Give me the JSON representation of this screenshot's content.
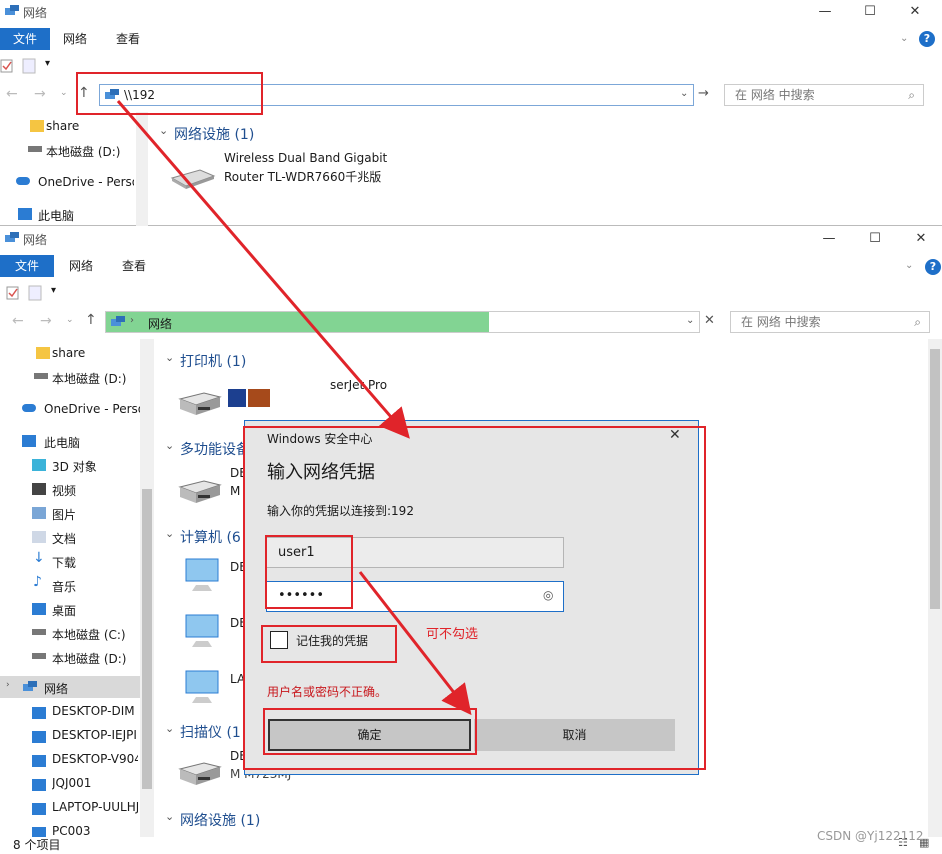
{
  "window1": {
    "title": "网络",
    "tabs": {
      "file": "文件",
      "network": "网络",
      "view": "查看"
    },
    "address": "\\\\192",
    "search_placeholder": "在 网络 中搜索",
    "nav": [
      "share",
      "本地磁盘 (D:)",
      "OneDrive - Perso",
      "此电脑"
    ],
    "group_header": "网络设施 (1)",
    "device_line1": "Wireless Dual Band Gigabit",
    "device_line2": "Router TL-WDR7660千兆版"
  },
  "window2": {
    "title": "网络",
    "tabs": {
      "file": "文件",
      "network": "网络",
      "view": "查看"
    },
    "breadcrumb": "网络",
    "search_placeholder": "在 网络 中搜索",
    "nav": [
      "share",
      "本地磁盘 (D:)",
      "OneDrive - Perso",
      "此电脑",
      "3D 对象",
      "视频",
      "图片",
      "文档",
      "下载",
      "音乐",
      "桌面",
      "本地磁盘 (C:)",
      "本地磁盘 (D:)",
      "网络",
      "DESKTOP-DIM",
      "DESKTOP-IEJPI",
      "DESKTOP-V904",
      "JQJ001",
      "LAPTOP-UULHJ",
      "PC003"
    ],
    "groups": {
      "printers": "打印机 (1)",
      "mfp": "多功能设备",
      "computers": "计算机 (6",
      "scanners": "扫描仪 (1",
      "netdev": "网络设施 (1)"
    },
    "printer_label": "serJet Pro",
    "item_de1": "DE",
    "item_m1": "M",
    "item_de2": "DE",
    "item_de3": "DE",
    "item_la": "LA",
    "item_de4": "DE",
    "item_m2": "M   M723MJ",
    "status": "8 个项目"
  },
  "dialog": {
    "header": "Windows 安全中心",
    "title": "输入网络凭据",
    "subtitle": "输入你的凭据以连接到:192",
    "username": "user1",
    "password": "••••••",
    "remember_label": "记住我的凭据",
    "error": "用户名或密码不正确。",
    "ok_label": "确定",
    "cancel_label": "取消"
  },
  "annotations": {
    "optional_note": "可不勾选"
  },
  "watermark": "CSDN @Yj122112",
  "colors": {
    "accent": "#1e6fc8",
    "annotation_red": "#e0242a",
    "breadcrumb_green": "#82d493"
  }
}
